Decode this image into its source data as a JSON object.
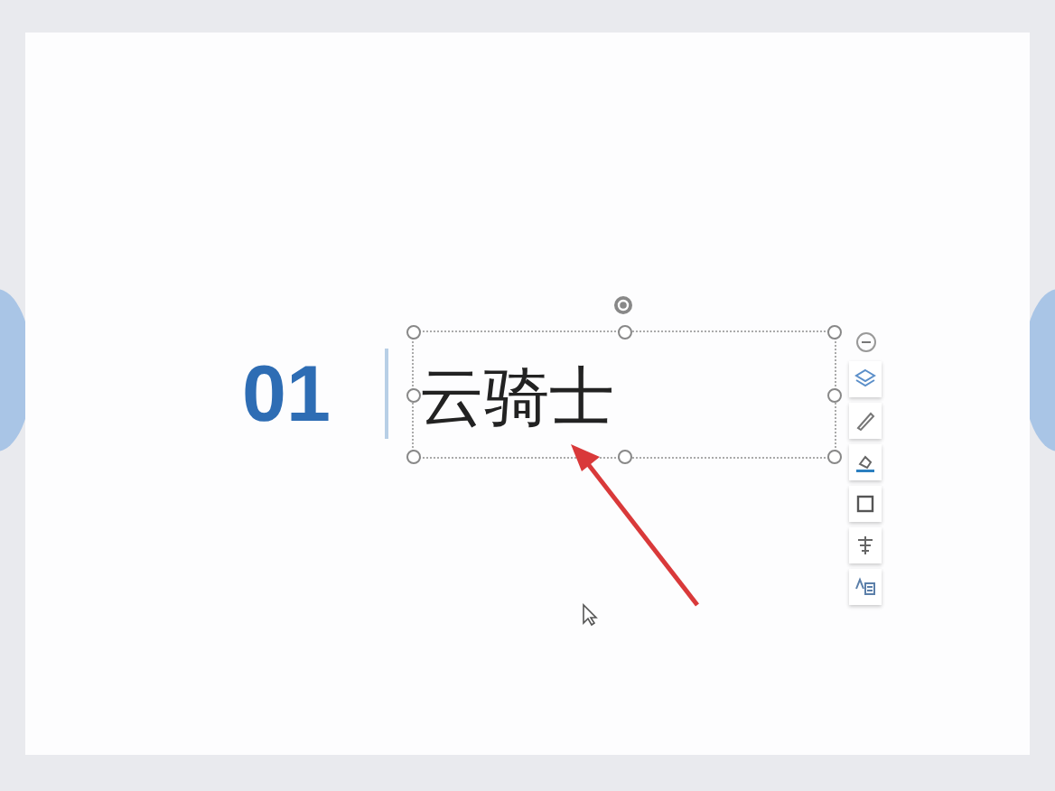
{
  "slide": {
    "number": "01",
    "text_box": {
      "text": "云骑士",
      "selected": true
    }
  },
  "floating_toolbar": {
    "collapse": true,
    "buttons": [
      {
        "kind": "layers"
      },
      {
        "kind": "pen"
      },
      {
        "kind": "fill"
      },
      {
        "kind": "outline"
      },
      {
        "kind": "text"
      },
      {
        "kind": "text-effect"
      }
    ]
  },
  "annotation": {
    "kind": "arrow"
  }
}
